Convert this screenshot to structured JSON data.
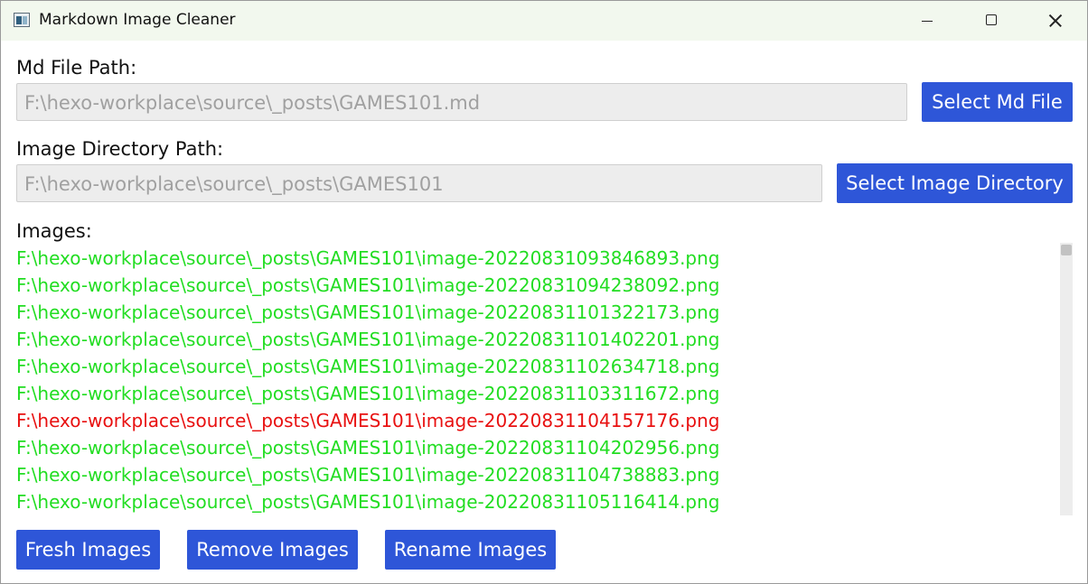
{
  "window": {
    "title": "Markdown Image Cleaner",
    "controls": {
      "minimize": "minimize-icon",
      "maximize": "maximize-icon",
      "close": "close-icon"
    }
  },
  "md_file": {
    "label": "Md File Path:",
    "value": "F:\\hexo-workplace\\source\\_posts\\GAMES101.md",
    "button": "Select Md File"
  },
  "image_dir": {
    "label": "Image Directory Path:",
    "value": "F:\\hexo-workplace\\source\\_posts\\GAMES101",
    "button": "Select Image Directory"
  },
  "images": {
    "label": "Images:",
    "items": [
      {
        "path": "F:\\hexo-workplace\\source\\_posts\\GAMES101\\image-20220831093846893.png",
        "color": "#22dd22"
      },
      {
        "path": "F:\\hexo-workplace\\source\\_posts\\GAMES101\\image-20220831094238092.png",
        "color": "#22dd22"
      },
      {
        "path": "F:\\hexo-workplace\\source\\_posts\\GAMES101\\image-20220831101322173.png",
        "color": "#22dd22"
      },
      {
        "path": "F:\\hexo-workplace\\source\\_posts\\GAMES101\\image-20220831101402201.png",
        "color": "#22dd22"
      },
      {
        "path": "F:\\hexo-workplace\\source\\_posts\\GAMES101\\image-20220831102634718.png",
        "color": "#22dd22"
      },
      {
        "path": "F:\\hexo-workplace\\source\\_posts\\GAMES101\\image-20220831103311672.png",
        "color": "#22dd22"
      },
      {
        "path": "F:\\hexo-workplace\\source\\_posts\\GAMES101\\image-20220831104157176.png",
        "color": "#e81010"
      },
      {
        "path": "F:\\hexo-workplace\\source\\_posts\\GAMES101\\image-20220831104202956.png",
        "color": "#22dd22"
      },
      {
        "path": "F:\\hexo-workplace\\source\\_posts\\GAMES101\\image-20220831104738883.png",
        "color": "#22dd22"
      },
      {
        "path": "F:\\hexo-workplace\\source\\_posts\\GAMES101\\image-20220831105116414.png",
        "color": "#22dd22"
      }
    ]
  },
  "actions": {
    "fresh": "Fresh Images",
    "remove": "Remove Images",
    "rename": "Rename Images"
  },
  "colors": {
    "button_bg": "#2e56d8",
    "titlebar_bg": "#f2f8ee",
    "used_image": "#22dd22",
    "unused_image": "#e81010"
  }
}
